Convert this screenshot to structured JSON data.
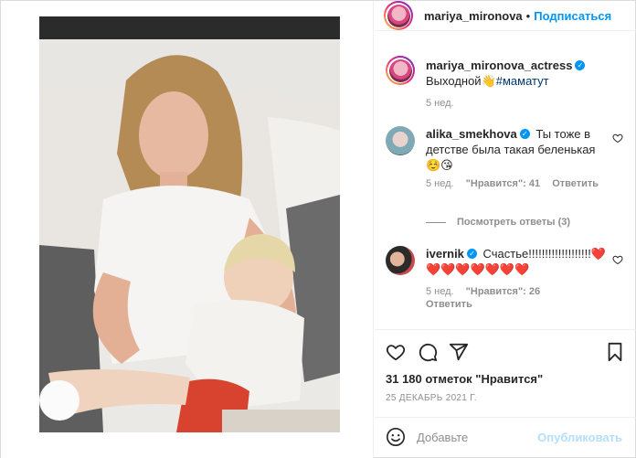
{
  "post": {
    "author": "mariya_mironova",
    "follow_label": "Подписаться",
    "separator": "•"
  },
  "caption": {
    "username": "mariya_mironova_actress",
    "text": "Выходной👋",
    "hashtag": "#маматут",
    "time": "5 нед."
  },
  "comments": [
    {
      "username": "alika_smekhova",
      "text": "Ты тоже в детстве была такая беленькая ☺️😘",
      "time": "5 нед.",
      "likes": "\"Нравится\": 41",
      "reply": "Ответить"
    },
    {
      "username": "ivernik",
      "text": "Счастье!!!!!!!!!!!!!!!!!!!❤️❤️❤️❤️❤️❤️❤️❤️",
      "time": "5 нед.",
      "likes": "\"Нравится\": 26",
      "reply": "Ответить"
    }
  ],
  "view_replies": "Посмотреть ответы (3)",
  "likes_total": "31 180 отметок \"Нравится\"",
  "date": "25 ДЕКАБРЬ 2021 Г.",
  "add_comment_placeholder": "Добавьте",
  "publish_label": "Опубликовать",
  "icons": [
    "heart-icon",
    "comment-icon",
    "share-icon",
    "bookmark-icon",
    "emoji-icon",
    "verified-icon"
  ]
}
